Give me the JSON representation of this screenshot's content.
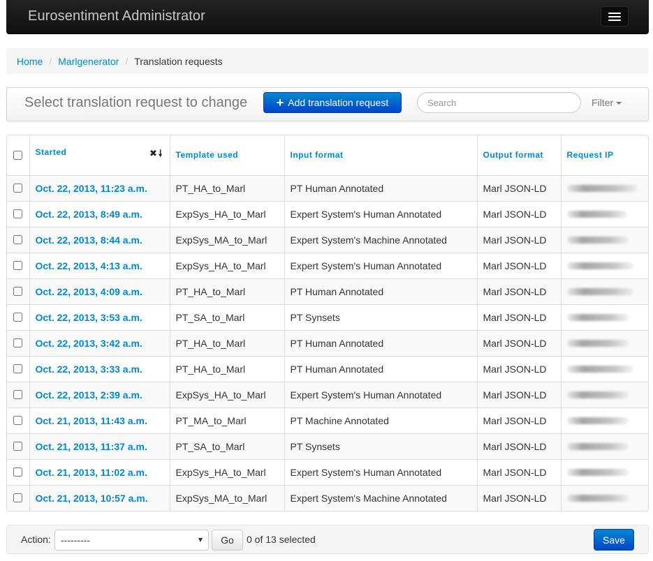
{
  "navbar": {
    "brand": "Eurosentiment Administrator",
    "menu_icon": "hamburger-menu-icon"
  },
  "breadcrumb": {
    "items": [
      {
        "label": "Home"
      },
      {
        "label": "Marlgenerator"
      }
    ],
    "separator": "/",
    "current": "Translation requests"
  },
  "toolbar": {
    "title": "Select translation request to change",
    "add_label": "Add translation request",
    "add_icon": "plus-icon",
    "search_placeholder": "Search",
    "filter_label": "Filter"
  },
  "table": {
    "columns": {
      "started": "Started",
      "template": "Template used",
      "input_format": "Input format",
      "output_format": "Output format",
      "request_ip": "Request IP"
    },
    "sort_icons": {
      "remove": "✖",
      "direction": "🠗"
    },
    "rows": [
      {
        "started": "Oct. 22, 2013, 11:23 a.m.",
        "template": "PT_HA_to_Marl",
        "input_format": "PT Human Annotated",
        "output_format": "Marl JSON-LD",
        "ip_blur": 0.92
      },
      {
        "started": "Oct. 22, 2013, 8:49 a.m.",
        "template": "ExpSys_HA_to_Marl",
        "input_format": "Expert System's Human Annotated",
        "output_format": "Marl JSON-LD",
        "ip_blur": 0.78
      },
      {
        "started": "Oct. 22, 2013, 8:44 a.m.",
        "template": "ExpSys_MA_to_Marl",
        "input_format": "Expert System's Machine Annotated",
        "output_format": "Marl JSON-LD",
        "ip_blur": 0.8
      },
      {
        "started": "Oct. 22, 2013, 4:13 a.m.",
        "template": "ExpSys_HA_to_Marl",
        "input_format": "Expert System's Human Annotated",
        "output_format": "Marl JSON-LD",
        "ip_blur": 0.86
      },
      {
        "started": "Oct. 22, 2013, 4:09 a.m.",
        "template": "PT_HA_to_Marl",
        "input_format": "PT Human Annotated",
        "output_format": "Marl JSON-LD",
        "ip_blur": 0.86
      },
      {
        "started": "Oct. 22, 2013, 3:53 a.m.",
        "template": "PT_SA_to_Marl",
        "input_format": "PT Synsets",
        "output_format": "Marl JSON-LD",
        "ip_blur": 0.8
      },
      {
        "started": "Oct. 22, 2013, 3:42 a.m.",
        "template": "PT_HA_to_Marl",
        "input_format": "PT Human Annotated",
        "output_format": "Marl JSON-LD",
        "ip_blur": 0.8
      },
      {
        "started": "Oct. 22, 2013, 3:33 a.m.",
        "template": "PT_HA_to_Marl",
        "input_format": "PT Human Annotated",
        "output_format": "Marl JSON-LD",
        "ip_blur": 0.86
      },
      {
        "started": "Oct. 22, 2013, 2:39 a.m.",
        "template": "ExpSys_HA_to_Marl",
        "input_format": "Expert System's Human Annotated",
        "output_format": "Marl JSON-LD",
        "ip_blur": 0.8
      },
      {
        "started": "Oct. 21, 2013, 11:43 a.m.",
        "template": "PT_MA_to_Marl",
        "input_format": "PT Machine Annotated",
        "output_format": "Marl JSON-LD",
        "ip_blur": 0.8
      },
      {
        "started": "Oct. 21, 2013, 11:37 a.m.",
        "template": "PT_SA_to_Marl",
        "input_format": "PT Synsets",
        "output_format": "Marl JSON-LD",
        "ip_blur": 0.8
      },
      {
        "started": "Oct. 21, 2013, 11:02 a.m.",
        "template": "ExpSys_HA_to_Marl",
        "input_format": "Expert System's Human Annotated",
        "output_format": "Marl JSON-LD",
        "ip_blur": 0.8
      },
      {
        "started": "Oct. 21, 2013, 10:57 a.m.",
        "template": "ExpSys_MA_to_Marl",
        "input_format": "Expert System's Machine Annotated",
        "output_format": "Marl JSON-LD",
        "ip_blur": 0.8
      }
    ]
  },
  "actions": {
    "label": "Action:",
    "select_value": "---------",
    "go_label": "Go",
    "selected_text": "0 of 13 selected",
    "save_label": "Save"
  },
  "colors": {
    "link": "#0088cc",
    "primary_button": "#0055cc",
    "navbar": "#1b1b1b"
  }
}
